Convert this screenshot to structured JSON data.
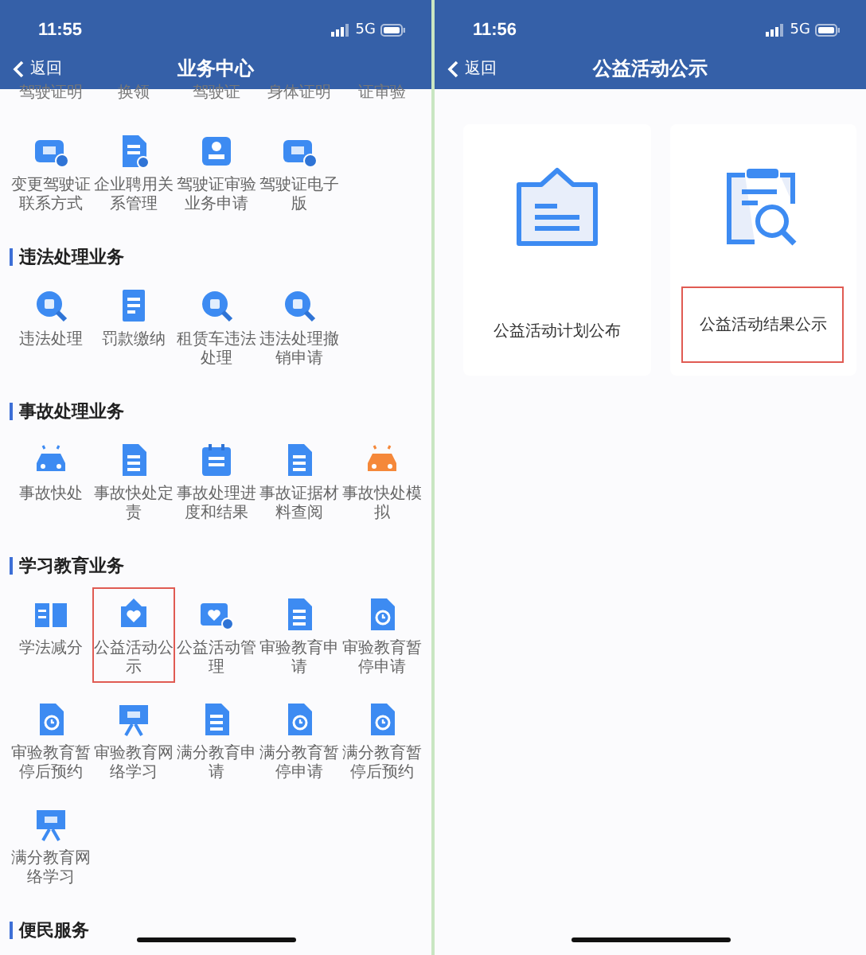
{
  "left": {
    "status": {
      "time": "11:55",
      "network": "5G"
    },
    "nav": {
      "back": "返回",
      "title": "业务中心"
    },
    "cut_labels": [
      "驾驶证明",
      "换领",
      "驾驶证",
      "身体证明",
      "证审验"
    ],
    "top_items": [
      {
        "label": "变更驾驶证联系方式",
        "kind": "license",
        "highlighted": false
      },
      {
        "label": "企业聘用关系管理",
        "kind": "doc",
        "highlighted": false
      },
      {
        "label": "驾驶证审验业务申请",
        "kind": "stamp",
        "highlighted": false
      },
      {
        "label": "驾驶证电子版",
        "kind": "license",
        "highlighted": false
      }
    ],
    "sections": [
      {
        "title": "违法处理业务",
        "items": [
          {
            "label": "违法处理",
            "kind": "search",
            "highlighted": false
          },
          {
            "label": "罚款缴纳",
            "kind": "receipt",
            "highlighted": false
          },
          {
            "label": "租赁车违法处理",
            "kind": "search",
            "highlighted": false
          },
          {
            "label": "违法处理撤销申请",
            "kind": "search",
            "highlighted": false
          }
        ]
      },
      {
        "title": "事故处理业务",
        "items": [
          {
            "label": "事故快处",
            "kind": "car",
            "highlighted": false
          },
          {
            "label": "事故快处定责",
            "kind": "doc",
            "highlighted": false
          },
          {
            "label": "事故处理进度和结果",
            "kind": "calendar",
            "highlighted": false
          },
          {
            "label": "事故证据材料查阅",
            "kind": "doc",
            "highlighted": false
          },
          {
            "label": "事故快处模拟",
            "kind": "warning-car",
            "highlighted": false
          }
        ]
      },
      {
        "title": "学习教育业务",
        "items": [
          {
            "label": "学法减分",
            "kind": "book",
            "highlighted": false
          },
          {
            "label": "公益活动公示",
            "kind": "heart-board",
            "highlighted": true
          },
          {
            "label": "公益活动管理",
            "kind": "heart-card",
            "highlighted": false
          },
          {
            "label": "审验教育申请",
            "kind": "doc",
            "highlighted": false
          },
          {
            "label": "审验教育暂停申请",
            "kind": "clock-doc",
            "highlighted": false
          },
          {
            "label": "审验教育暂停后预约",
            "kind": "clock-doc",
            "highlighted": false
          },
          {
            "label": "审验教育网络学习",
            "kind": "screen",
            "highlighted": false
          },
          {
            "label": "满分教育申请",
            "kind": "doc",
            "highlighted": false
          },
          {
            "label": "满分教育暂停申请",
            "kind": "clock-doc",
            "highlighted": false
          },
          {
            "label": "满分教育暂停后预约",
            "kind": "clock-doc",
            "highlighted": false
          },
          {
            "label": "满分教育网络学习",
            "kind": "screen",
            "highlighted": false
          }
        ]
      },
      {
        "title": "便民服务"
      }
    ]
  },
  "right": {
    "status": {
      "time": "11:56",
      "network": "5G"
    },
    "nav": {
      "back": "返回",
      "title": "公益活动公示"
    },
    "cards": [
      {
        "label": "公益活动计划公布",
        "kind": "board",
        "highlighted": false
      },
      {
        "label": "公益活动结果公示",
        "kind": "clipboard-search",
        "highlighted": true
      }
    ]
  }
}
